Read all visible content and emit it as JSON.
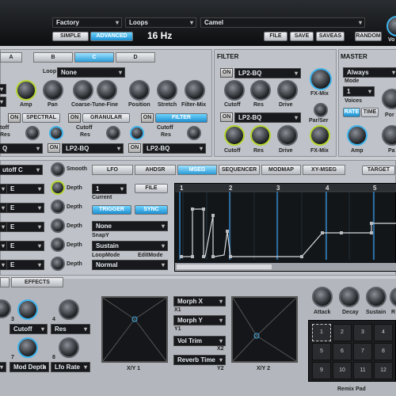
{
  "header": {
    "bank_select": "Factory",
    "category_select": "Loops",
    "preset_select": "Camel",
    "simple_label": "SIMPLE",
    "advanced_label": "ADVANCED",
    "display_value": "16 Hz",
    "file_label": "FILE",
    "save_label": "SAVE",
    "saveas_label": "SAVEAS",
    "random_label": "RANDOM",
    "volume_label": "Vo"
  },
  "layer_tabs": [
    "A",
    "B",
    "C",
    "D"
  ],
  "source": {
    "loop_label": "Loop",
    "loop_value": "None",
    "knobs": [
      "Amp",
      "Pan",
      "Coarse-Tune-Fine",
      "Position",
      "Stretch",
      "Filter-Mix"
    ],
    "spectral_label": "SPECTRAL",
    "granular_label": "GRANULAR",
    "filter_label": "FILTER",
    "on_label": "ON",
    "cutoff_label": "Cutoff",
    "res_label": "Res",
    "filter_type_1": "LP2-BQ",
    "filter_type_2": "LP2-BQ",
    "left_cutoff": "toff",
    "left_res": "Res",
    "left_q": "Q"
  },
  "filter": {
    "title": "FILTER",
    "type_a": "LP2-BQ",
    "type_b": "LP2-BQ",
    "knobs": [
      "Cutoff",
      "Res",
      "Drive",
      "FX-Mix"
    ],
    "par_ser": "Par/Ser"
  },
  "master": {
    "title": "MASTER",
    "mode_select": "Always",
    "mode_label": "Mode",
    "voices_value": "1",
    "voices_label": "Voices",
    "rate_label": "RATE",
    "time_label": "TIME",
    "por_label": "Por",
    "amp_label": "Amp",
    "pan_label": "Pa"
  },
  "mod": {
    "cutoff_select": "utoff C",
    "smooth_label": "Smooth",
    "depth_label": "Depth",
    "rows": [
      "E",
      "E",
      "E",
      "E",
      "E"
    ],
    "tabs": [
      "LFO",
      "AHDSR",
      "MSEG",
      "SEQUENCER",
      "MODMAP",
      "XY-MSEG"
    ],
    "target_label": "TARGET",
    "current_value": "1",
    "current_label": "Current",
    "file_label": "FILE",
    "trigger_label": "TRIGGER",
    "sync_label": "SYNC",
    "snap_value": "None",
    "snap_label": "SnapY",
    "loopmode_value": "Sustain",
    "loopmode_label": "LoopMode",
    "editmode_label": "EditMode",
    "normal_value": "Normal",
    "ruler": [
      "1",
      "2",
      "3",
      "4",
      "5"
    ]
  },
  "bottom": {
    "effects_label": "EFFECTS",
    "knob_labels": [
      "Cutoff",
      "Res",
      "Mod Depth",
      "Lfo Rate"
    ],
    "knob_nums": [
      "3",
      "4",
      "7",
      "8"
    ],
    "xy1_label": "X/Y 1",
    "xy2_label": "X/Y 2",
    "morph_x": "Morph X",
    "x1": "X1",
    "morph_y": "Morph Y",
    "y1": "Y1",
    "vol_trim": "Vol Trim",
    "x2": "X2",
    "reverb_time": "Reverb Time",
    "y2": "Y2",
    "env_knobs": [
      "Attack",
      "Decay",
      "Sustain",
      "R"
    ],
    "pad_cells": [
      "1",
      "2",
      "3",
      "4",
      "5",
      "6",
      "7",
      "8",
      "9",
      "10",
      "11",
      "12"
    ],
    "remix_label": "Remix Pad"
  },
  "colors": {
    "accent_blue": "#41b3ec",
    "accent_green": "#b4d632",
    "panel": "#bfc3c9"
  }
}
